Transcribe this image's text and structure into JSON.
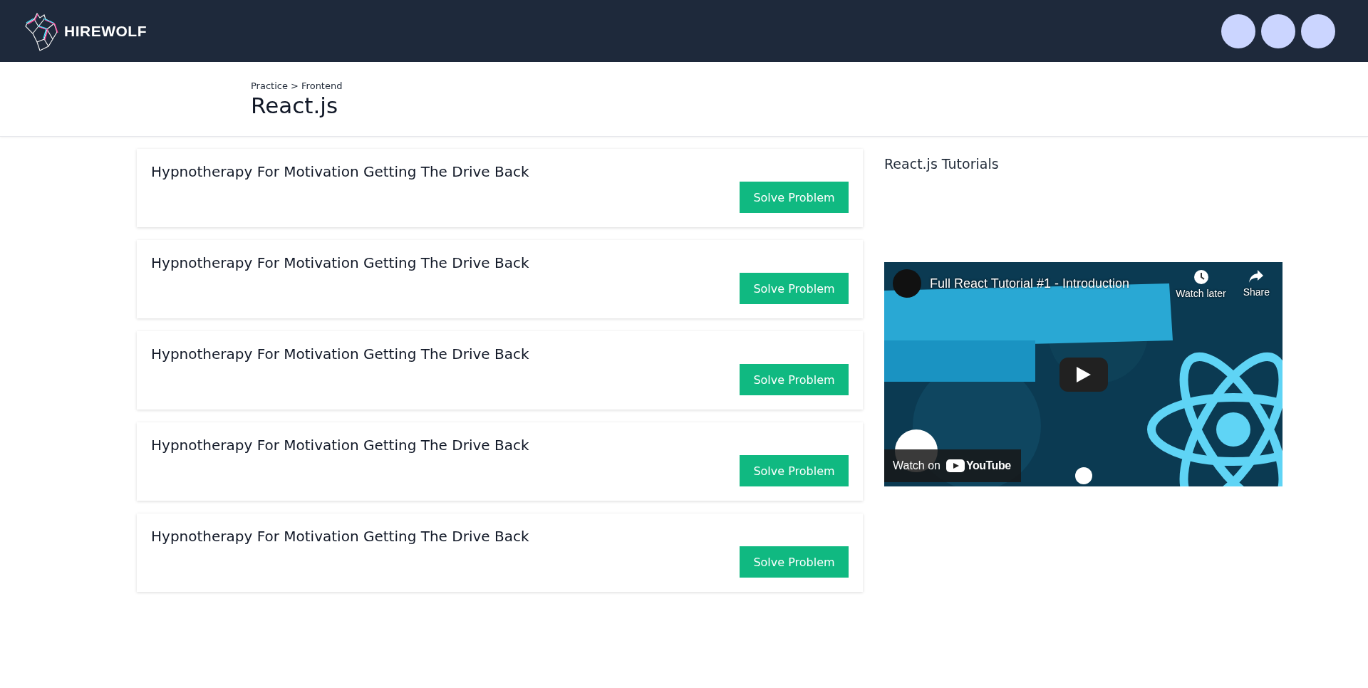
{
  "header": {
    "logo_text": "HIREWOLF",
    "avatars": [
      {
        "color": "#cbd5ff"
      },
      {
        "color": "#cbd5ff"
      },
      {
        "color": "#cbd5ff"
      }
    ]
  },
  "page": {
    "breadcrumb": [
      "Practice",
      "Frontend"
    ],
    "breadcrumb_separator": ">",
    "title": "React.js"
  },
  "problems": [
    {
      "title": "Hypnotherapy For Motivation Getting The Drive Back",
      "button": "Solve Problem"
    },
    {
      "title": "Hypnotherapy For Motivation Getting The Drive Back",
      "button": "Solve Problem"
    },
    {
      "title": "Hypnotherapy For Motivation Getting The Drive Back",
      "button": "Solve Problem"
    },
    {
      "title": "Hypnotherapy For Motivation Getting The Drive Back",
      "button": "Solve Problem"
    },
    {
      "title": "Hypnotherapy For Motivation Getting The Drive Back",
      "button": "Solve Problem"
    }
  ],
  "tutorials": {
    "heading": "React.js Tutorials",
    "video": {
      "kind": "picture",
      "title": "Full React Tutorial #1 - Introduction",
      "actions": [
        {
          "kind": "clock",
          "label": "Watch later"
        },
        {
          "kind": "share",
          "label": "Share"
        }
      ],
      "watch_on": "Watch on",
      "brand": "YouTube"
    }
  }
}
